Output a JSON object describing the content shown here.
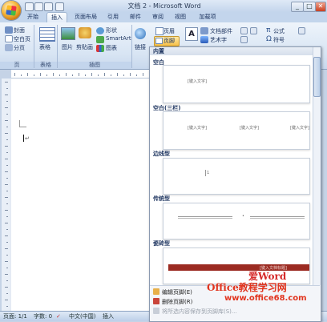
{
  "window": {
    "title": "文档 2 - Microsoft Word"
  },
  "tabs": [
    {
      "label": "开始"
    },
    {
      "label": "插入"
    },
    {
      "label": "页面布局"
    },
    {
      "label": "引用"
    },
    {
      "label": "邮件"
    },
    {
      "label": "审阅"
    },
    {
      "label": "视图"
    },
    {
      "label": "加载项"
    }
  ],
  "ribbon": {
    "pages": {
      "cover": "封面",
      "blank": "空白页",
      "break": "分页",
      "group": "页"
    },
    "table": {
      "label": "表格",
      "group": "表格"
    },
    "illustrations": {
      "picture": "图片",
      "clipart": "剪贴画",
      "shapes": "形状",
      "smartart": "SmartArt",
      "chart": "图表",
      "group": "插图"
    },
    "links": {
      "label": "链接"
    },
    "header_footer": {
      "header": "页眉",
      "footer": "页脚"
    },
    "text": {
      "textbox": "文本框",
      "docparts": "文档部件",
      "wordart": "艺术字"
    },
    "symbols": {
      "equation": "公式",
      "symbol": "符号"
    }
  },
  "gallery": {
    "section_header": "内置",
    "items": [
      {
        "name": "空白",
        "placeholders": [
          "[键入文字]"
        ]
      },
      {
        "name": "空白(三栏)",
        "placeholders": [
          "[键入文字]",
          "[键入文字]",
          "[键入文字]"
        ]
      },
      {
        "name": "边线型"
      },
      {
        "name": "传统型"
      },
      {
        "name": "瓷砖型",
        "placeholders": [
          "[键入文档标题]"
        ]
      }
    ],
    "footer": [
      {
        "label": "编辑页脚(E)"
      },
      {
        "label": "删除页脚(R)"
      },
      {
        "label": "将所选内容保存到页脚库(S)..."
      }
    ]
  },
  "status": {
    "page": "页面: 1/1",
    "words": "字数: 0",
    "lang": "中文(中国)",
    "mode": "插入"
  },
  "watermark": {
    "brand": "爱Word",
    "line1": "Office教程学习网",
    "line2": "www.office68.com"
  },
  "colors": {
    "accent": "#c3d5ec",
    "tile_band": "#9b2b22"
  }
}
